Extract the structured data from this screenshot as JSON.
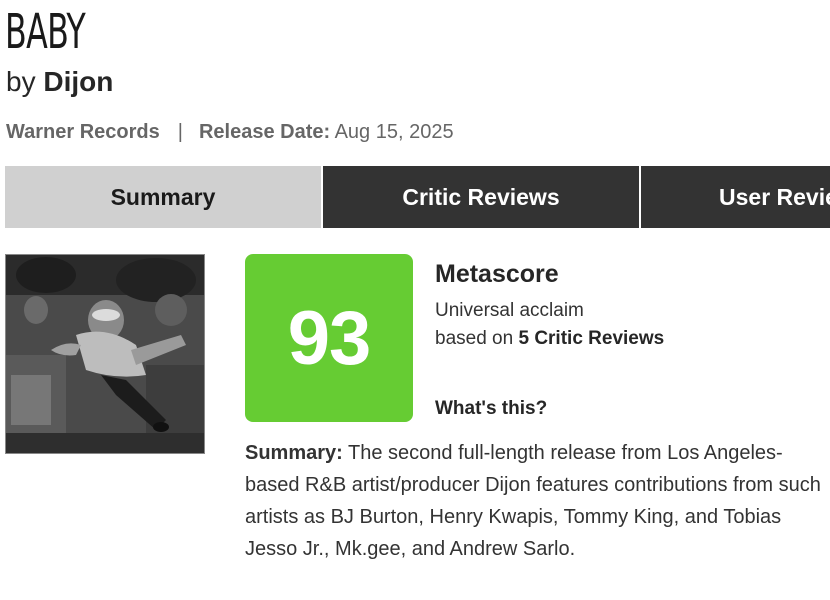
{
  "album": {
    "title": "BABY",
    "by_prefix": "by",
    "artist": "Dijon",
    "label": "Warner Records",
    "separator": "|",
    "release_label": "Release Date:",
    "release_date": "Aug 15, 2025"
  },
  "tabs": [
    {
      "label": "Summary",
      "active": true
    },
    {
      "label": "Critic Reviews",
      "active": false
    },
    {
      "label": "User Reviews",
      "active": false
    }
  ],
  "metascore": {
    "score": "93",
    "score_color": "#66cc33",
    "title": "Metascore",
    "acclaim": "Universal acclaim",
    "based_on_prefix": "based on",
    "review_count": "5 Critic Reviews",
    "whats_this": "What's this?"
  },
  "summary": {
    "label": "Summary:",
    "text": "The second full-length release from Los Angeles-based R&B artist/producer Dijon features contributions from such artists as BJ Burton, Henry Kwapis, Tommy King, and Tobias Jesso Jr., Mk.gee, and Andrew Sarlo."
  },
  "colors": {
    "tab_dark": "#333333",
    "tab_active": "#d0d0d0",
    "meta_gray": "#666666"
  }
}
